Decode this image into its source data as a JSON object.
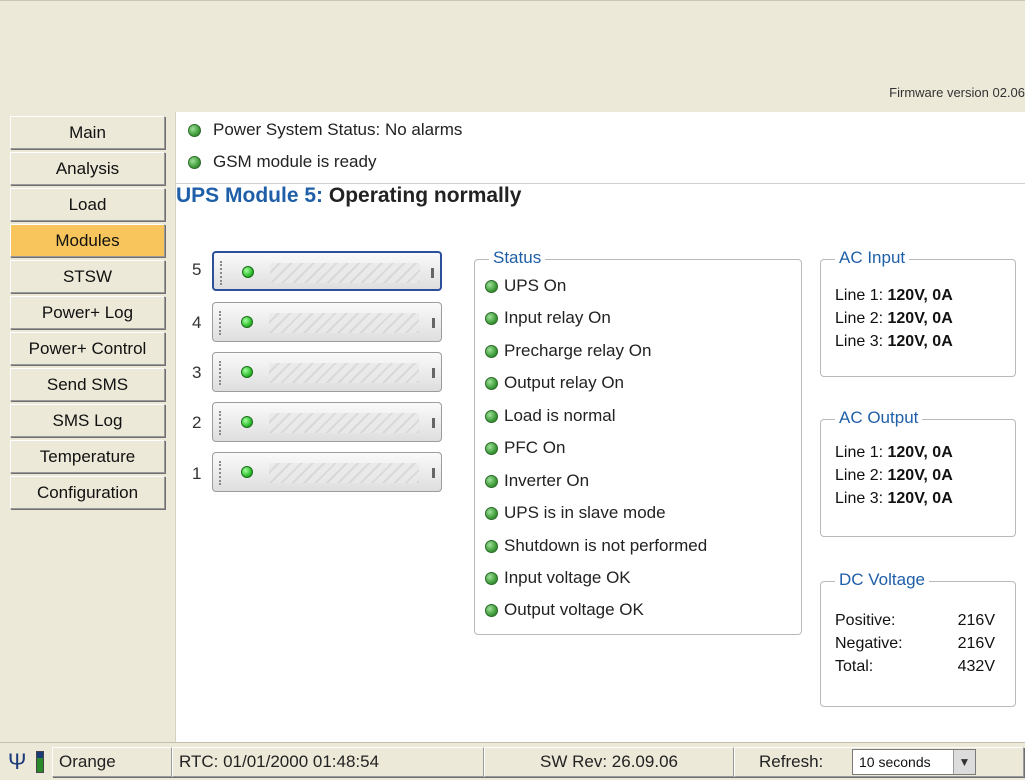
{
  "header": {
    "firmware": "Firmware version 02.06"
  },
  "nav": {
    "items": [
      {
        "label": "Main"
      },
      {
        "label": "Analysis"
      },
      {
        "label": "Load"
      },
      {
        "label": "Modules"
      },
      {
        "label": "STSW"
      },
      {
        "label": "Power+ Log"
      },
      {
        "label": "Power+ Control"
      },
      {
        "label": "Send SMS"
      },
      {
        "label": "SMS Log"
      },
      {
        "label": "Temperature"
      },
      {
        "label": "Configuration"
      }
    ],
    "active": "Modules"
  },
  "alerts": [
    {
      "text": "Power System Status:  No alarms"
    },
    {
      "text": "GSM module is ready"
    }
  ],
  "headline": {
    "module": "UPS Module 5:",
    "state": "Operating normally"
  },
  "rack": {
    "modules": [
      "5",
      "4",
      "3",
      "2",
      "1"
    ],
    "selected": "5"
  },
  "status": {
    "title": "Status",
    "items": [
      "UPS On",
      "Input relay On",
      "Precharge relay On",
      "Output relay On",
      "Load is normal",
      "PFC On",
      "Inverter On",
      "UPS is in slave mode",
      "Shutdown is not performed",
      "Input voltage OK",
      "Output voltage OK"
    ]
  },
  "ac_input": {
    "title": "AC Input",
    "lines": [
      {
        "label": "Line 1:",
        "value": "120V, 0A"
      },
      {
        "label": "Line 2:",
        "value": "120V, 0A"
      },
      {
        "label": "Line 3:",
        "value": "120V, 0A"
      }
    ]
  },
  "ac_output": {
    "title": "AC Output",
    "lines": [
      {
        "label": "Line 1:",
        "value": "120V, 0A"
      },
      {
        "label": "Line 2:",
        "value": "120V, 0A"
      },
      {
        "label": "Line 3:",
        "value": "120V, 0A"
      }
    ]
  },
  "dc_voltage": {
    "title": "DC Voltage",
    "lines": [
      {
        "label": "Positive:",
        "value": "216V"
      },
      {
        "label": "Negative:",
        "value": "216V"
      },
      {
        "label": "Total:",
        "value": "432V"
      }
    ]
  },
  "statusbar": {
    "operator": "Orange",
    "rtc": "RTC: 01/01/2000 01:48:54",
    "sw_rev": "SW Rev: 26.09.06",
    "refresh_label": "Refresh:",
    "refresh_value": "10 seconds"
  }
}
